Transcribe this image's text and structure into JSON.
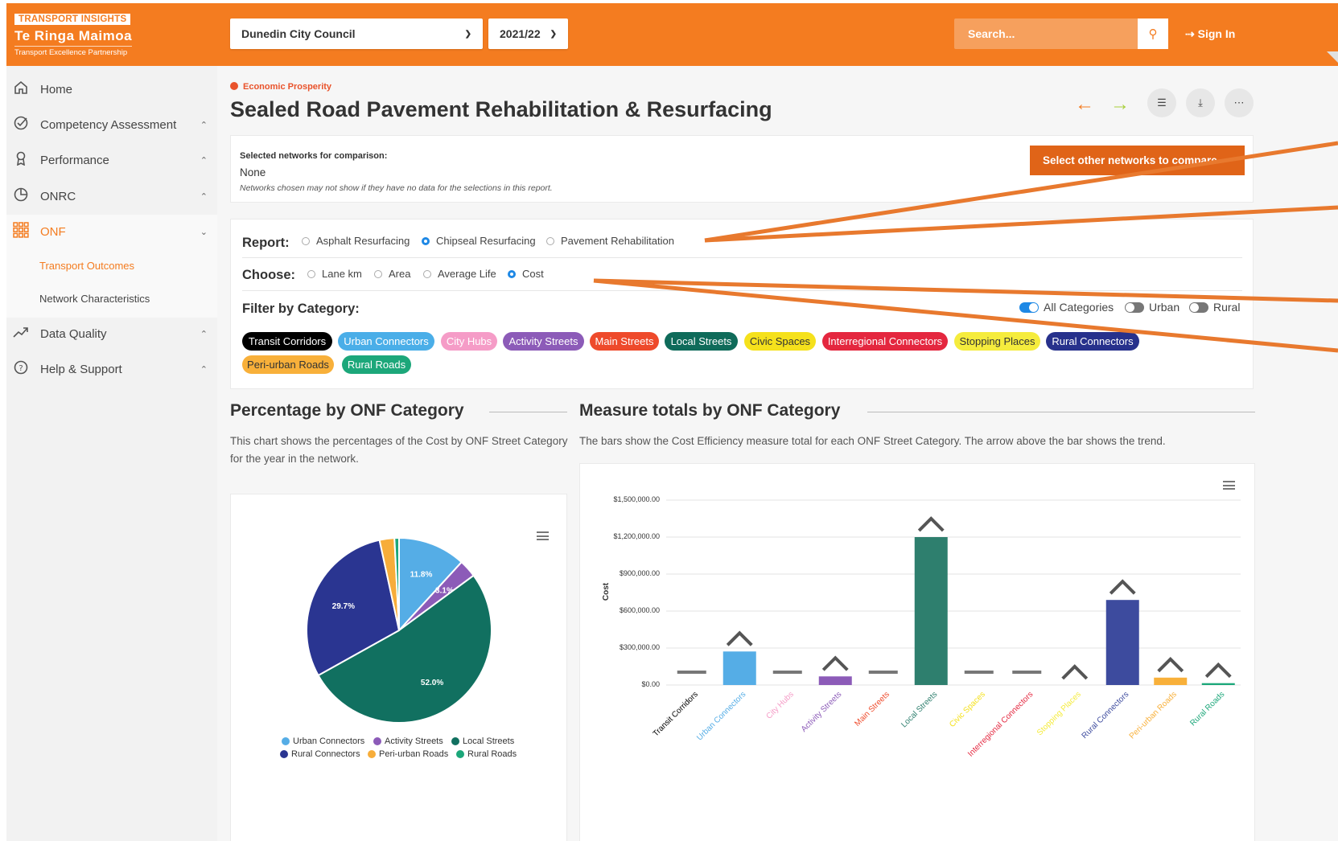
{
  "header": {
    "logo_badge": "TRANSPORT INSIGHTS",
    "logo_title": "Te Ringa Maimoa",
    "logo_subtitle": "Transport Excellence Partnership",
    "council": "Dunedin City Council",
    "year": "2021/22",
    "search_placeholder": "Search...",
    "signin": "Sign In"
  },
  "sidebar": {
    "items": [
      {
        "label": "Home",
        "icon": "home-icon"
      },
      {
        "label": "Competency Assessment",
        "icon": "check-circle-icon"
      },
      {
        "label": "Performance",
        "icon": "award-icon"
      },
      {
        "label": "ONRC",
        "icon": "pie-icon"
      },
      {
        "label": "ONF",
        "icon": "grid-icon"
      },
      {
        "label": "Data Quality",
        "icon": "trend-icon"
      },
      {
        "label": "Help & Support",
        "icon": "help-icon"
      }
    ],
    "onf_sub": [
      "Transport Outcomes",
      "Network Characteristics"
    ]
  },
  "page": {
    "tag": "Economic Prosperity",
    "title": "Sealed Road Pavement Rehabilitation & Resurfacing"
  },
  "compare": {
    "label": "Selected networks for comparison:",
    "value": "None",
    "note": "Networks chosen may not show if they have no data for the selections in this report.",
    "button": "Select other networks to compare"
  },
  "report": {
    "label": "Report:",
    "options": [
      "Asphalt Resurfacing",
      "Chipseal Resurfacing",
      "Pavement Rehabilitation"
    ],
    "selected": 1
  },
  "choose": {
    "label": "Choose:",
    "options": [
      "Lane km",
      "Area",
      "Average Life",
      "Cost"
    ],
    "selected": 3
  },
  "filter": {
    "label": "Filter by Category:",
    "toggles": [
      {
        "label": "All Categories",
        "on": true
      },
      {
        "label": "Urban",
        "on": false
      },
      {
        "label": "Rural",
        "on": false
      }
    ],
    "chips": [
      {
        "label": "Transit Corridors",
        "color": "#000000"
      },
      {
        "label": "Urban Connectors",
        "color": "#4aaee8"
      },
      {
        "label": "City Hubs",
        "color": "#f59cc7"
      },
      {
        "label": "Activity Streets",
        "color": "#8c5bb8"
      },
      {
        "label": "Main Streets",
        "color": "#ee4a2b"
      },
      {
        "label": "Local Streets",
        "color": "#0f6b5a"
      },
      {
        "label": "Civic Spaces",
        "color": "#f5e11c"
      },
      {
        "label": "Interregional Connectors",
        "color": "#e4273f"
      },
      {
        "label": "Stopping Places",
        "color": "#f5ec3d"
      },
      {
        "label": "Rural Connectors",
        "color": "#27318c"
      },
      {
        "label": "Peri-urban Roads",
        "color": "#f8b03a"
      },
      {
        "label": "Rural Roads",
        "color": "#1ca77a"
      }
    ]
  },
  "pie_section": {
    "title": "Percentage by ONF Category",
    "description": "This chart shows the percentages of the Cost by ONF Street Category for the year in the network."
  },
  "bar_section": {
    "title": "Measure totals by ONF Category",
    "description": "The bars show the Cost Efficiency measure total for each ONF Street Category. The arrow above the bar shows the trend."
  },
  "chart_data": [
    {
      "type": "pie",
      "slices": [
        {
          "name": "Urban Connectors",
          "value": 11.8,
          "color": "#55ade6",
          "label": "11.8%"
        },
        {
          "name": "Activity Streets",
          "value": 3.1,
          "color": "#8c5bb8",
          "label": "3.1%"
        },
        {
          "name": "Local Streets",
          "value": 52.0,
          "color": "#117060",
          "label": "52.0%"
        },
        {
          "name": "Rural Connectors",
          "value": 29.7,
          "color": "#2a3591",
          "label": "29.7%"
        },
        {
          "name": "Peri-urban Roads",
          "value": 2.6,
          "color": "#f7ad3a",
          "label": ""
        },
        {
          "name": "Rural Roads",
          "value": 0.8,
          "color": "#1ca77a",
          "label": ""
        }
      ],
      "legend": [
        "Urban Connectors",
        "Activity Streets",
        "Local Streets",
        "Rural Connectors",
        "Peri-urban Roads",
        "Rural Roads"
      ]
    },
    {
      "type": "bar",
      "ylabel": "Cost",
      "ylim": [
        0,
        1500000
      ],
      "yticks": [
        "$0.00",
        "$300,000.00",
        "$600,000.00",
        "$900,000.00",
        "$1,200,000.00",
        "$1,500,000.00"
      ],
      "ytick_values": [
        0,
        300000,
        600000,
        900000,
        1200000,
        1500000
      ],
      "categories": [
        "Transit Corridors",
        "Urban Connectors",
        "City Hubs",
        "Activity Streets",
        "Main Streets",
        "Local Streets",
        "Civic Spaces",
        "Interregional Connectors",
        "Stopping Places",
        "Rural Connectors",
        "Peri-urban Roads",
        "Rural Roads"
      ],
      "values": [
        0,
        272000,
        0,
        70000,
        0,
        1200000,
        0,
        0,
        0,
        690000,
        60000,
        15000
      ],
      "colors": [
        "#000000",
        "#55ade6",
        "#f59cc7",
        "#8c5bb8",
        "#ee4a2b",
        "#2e7f6e",
        "#f5e11c",
        "#e4273f",
        "#f5ec3d",
        "#3d4b9e",
        "#f8b03a",
        "#1ca77a"
      ],
      "trend": [
        "flat",
        "up",
        "flat",
        "up",
        "flat",
        "up",
        "flat",
        "flat",
        "up",
        "up",
        "up",
        "up"
      ]
    }
  ]
}
